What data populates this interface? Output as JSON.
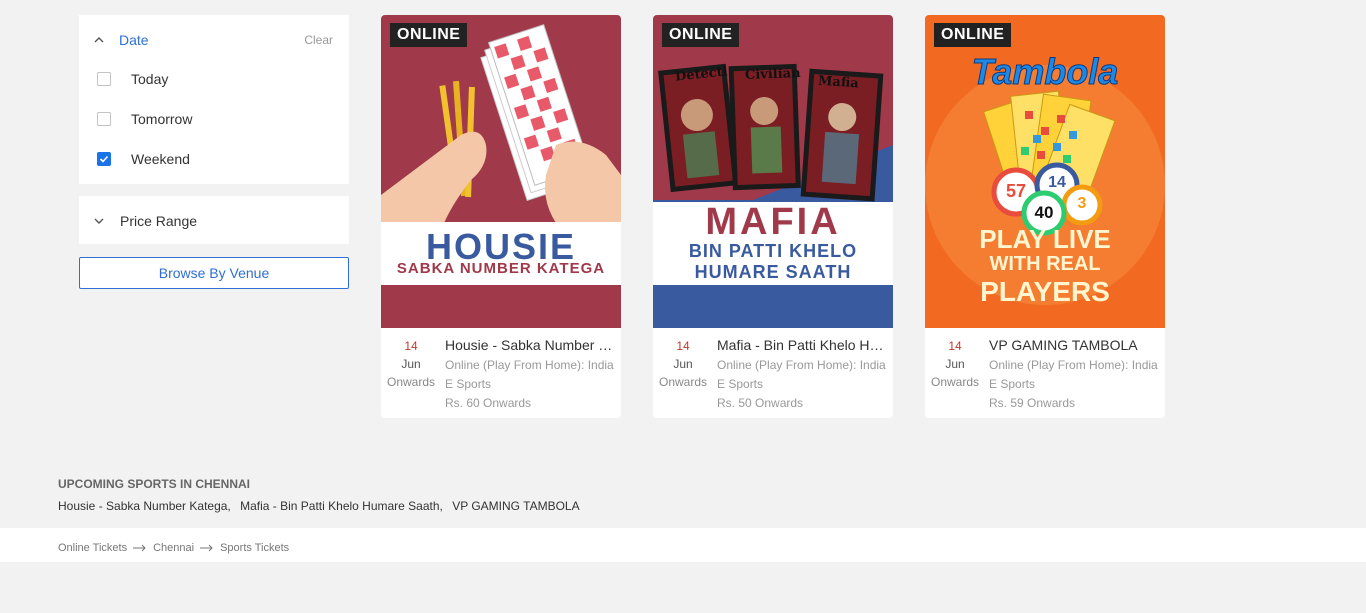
{
  "filters": {
    "date": {
      "title": "Date",
      "clear": "Clear",
      "options": [
        {
          "label": "Today",
          "checked": false
        },
        {
          "label": "Tomorrow",
          "checked": false
        },
        {
          "label": "Weekend",
          "checked": true
        }
      ]
    },
    "price": {
      "title": "Price Range"
    },
    "browse_button": "Browse By Venue"
  },
  "events": [
    {
      "badge": "ONLINE",
      "poster_title": "HOUSIE",
      "poster_subtitle": "SABKA NUMBER KATEGA",
      "day": "14",
      "month": "Jun",
      "onwards": "Onwards",
      "title": "Housie - Sabka Number Katega",
      "venue": "Online (Play From Home): India",
      "category": "E Sports",
      "price": "Rs. 60 Onwards"
    },
    {
      "badge": "ONLINE",
      "poster_title": "MAFIA",
      "poster_subtitle_1": "BIN PATTI KHELO",
      "poster_subtitle_2": "HUMARE SAATH",
      "poster_cards": [
        "Detecti",
        "Civilian",
        "Mafia"
      ],
      "day": "14",
      "month": "Jun",
      "onwards": "Onwards",
      "title": "Mafia - Bin Patti Khelo Humare Saath",
      "venue": "Online (Play From Home): India",
      "category": "E Sports",
      "price": "Rs. 50 Onwards"
    },
    {
      "badge": "ONLINE",
      "poster_title": "Tambola",
      "poster_line1": "PLAY LIVE",
      "poster_line2a": "WITH REAL ",
      "poster_line2b": "PLAYERS",
      "poster_balls": [
        "57",
        "14",
        "40",
        "3"
      ],
      "day": "14",
      "month": "Jun",
      "onwards": "Onwards",
      "title": "VP GAMING TAMBOLA",
      "venue": "Online (Play From Home): India",
      "category": "E Sports",
      "price": "Rs. 59 Onwards"
    }
  ],
  "upcoming": {
    "heading": "UPCOMING SPORTS IN CHENNAI",
    "links": [
      "Housie - Sabka Number Katega,",
      "Mafia - Bin Patti Khelo Humare Saath,",
      "VP GAMING TAMBOLA"
    ]
  },
  "breadcrumb": [
    "Online Tickets",
    "Chennai",
    "Sports Tickets"
  ],
  "colors": {
    "accent": "#2f6fd6",
    "checkbox": "#1a73e8",
    "housie_bg": "#a03a4a",
    "tambola_bg": "#f26a21",
    "mafia_blue": "#3a5aa0"
  }
}
